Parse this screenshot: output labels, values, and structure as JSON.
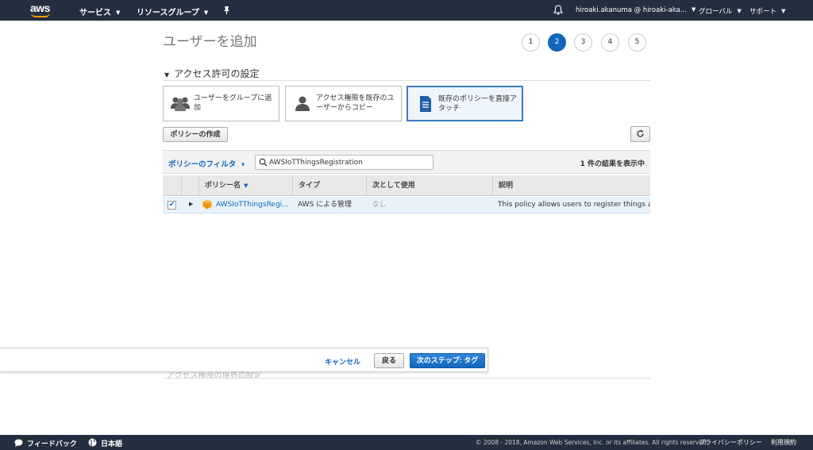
{
  "topbar": {
    "logo_text": "aws",
    "services": "サービス",
    "resource_groups": "リソースグループ",
    "account": "hiroaki.akanuma @ hiroaki-aka...",
    "region": "グローバル",
    "support": "サポート"
  },
  "page": {
    "title": "ユーザーを追加",
    "steps": [
      "1",
      "2",
      "3",
      "4",
      "5"
    ],
    "active_step": 2
  },
  "permissions": {
    "section_title": "アクセス許可の設定",
    "options": [
      {
        "label": "ユーザーをグループに追加",
        "icon": "users-group-icon"
      },
      {
        "label": "アクセス権限を既存のユーザーからコピー",
        "icon": "user-icon"
      },
      {
        "label": "既存のポリシーを直接アタッチ",
        "icon": "document-icon"
      }
    ],
    "create_policy": "ポリシーの作成"
  },
  "filter": {
    "label": "ポリシーのフィルタ",
    "search_value": "AWSIoTThingsRegistration",
    "result_count": "1 件の結果を表示中"
  },
  "table": {
    "headers": {
      "name": "ポリシー名",
      "type": "タイプ",
      "used_as": "次として使用",
      "description": "説明"
    },
    "rows": [
      {
        "name": "AWSIoTThingsRegi...",
        "type": "AWS による管理",
        "used_as": "なし",
        "description": "This policy allows users to register things at..."
      }
    ]
  },
  "ghost_section": "アクセス権限の境界の設定",
  "actions": {
    "cancel": "キャンセル",
    "back": "戻る",
    "next": "次のステップ: タグ"
  },
  "footer": {
    "feedback": "フィードバック",
    "language": "日本語",
    "copyright": "© 2008 - 2018, Amazon Web Services, Inc. or its affiliates. All rights reserved.",
    "privacy": "プライバシーポリシー",
    "terms": "利用規約"
  },
  "colors": {
    "nav_bg": "#232f3e",
    "accent": "#1166bb",
    "logo_orange": "#ff9900"
  }
}
